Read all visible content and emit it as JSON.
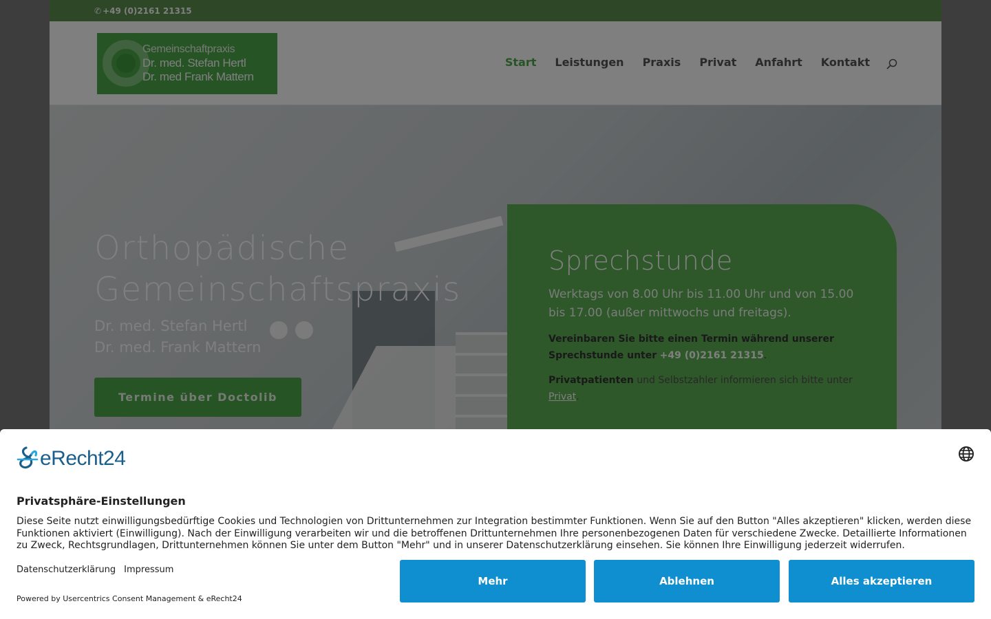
{
  "topbar": {
    "phone": "+49 (0)2161 21315"
  },
  "logo": {
    "line1": "Gemeinschaftpraxis",
    "line2": "Dr. med. Stefan Hertl",
    "line3": "Dr. med Frank Mattern"
  },
  "nav": {
    "items": [
      {
        "label": "Start",
        "active": true
      },
      {
        "label": "Leistungen"
      },
      {
        "label": "Praxis"
      },
      {
        "label": "Privat"
      },
      {
        "label": "Anfahrt"
      },
      {
        "label": "Kontakt"
      }
    ]
  },
  "hero": {
    "title_line1": "Orthopädische",
    "title_line2": "Gemeinschaftspraxis",
    "doctor1": "Dr. med. Stefan Hertl",
    "doctor2": "Dr. med. Frank Mattern",
    "cta": "Termine über Doctolib"
  },
  "card": {
    "title": "Sprechstunde",
    "hours": "Werktags von 8.00 Uhr bis 11.00 Uhr und von 15.00 bis 17.00 (außer mittwochs und freitags).",
    "appointment_text": "Vereinbaren Sie bitte einen Termin während unserer Sprechstunde unter",
    "phone": "+49 (0)2161 21315",
    "period": ".",
    "private_bold": "Privatpatienten",
    "private_text": " und Selbstzahler informieren sich bitte unter ",
    "private_link": "Privat",
    "private_end": "."
  },
  "consent": {
    "brand": "eRecht24",
    "title": "Privatsphäre-Einstellungen",
    "text": "Diese Seite nutzt einwilligungsbedürftige Cookies und Technologien von Drittunternehmen zur Integration bestimmter Funktionen. Wenn Sie auf den Button \"Alles akzeptieren\" klicken, werden diese Funktionen aktiviert (Einwilligung). Nach der Einwilligung verarbeiten wir und die betroffenen Drittunternehmen Ihre personenbezogenen Daten für verschiedene Zwecke. Detaillierte Informationen zu Zweck, Rechtsgrundlagen, Drittunternehmen können Sie unter dem Button \"Mehr\" und in unserer Datenschutzerklärung einsehen. Sie können Ihre Einwilligung jederzeit widerrufen.",
    "link_privacy": "Datenschutzerklärung",
    "link_imprint": "Impressum",
    "powered": "Powered by Usercentrics Consent Management & eRecht24",
    "btn_more": "Mehr",
    "btn_deny": "Ablehnen",
    "btn_accept": "Alles akzeptieren"
  },
  "colors": {
    "brand_green": "#4fa84a",
    "topbar_green": "#5a8e4e",
    "button_blue": "#0f8fd0",
    "brand_blue": "#1a5f8c"
  }
}
